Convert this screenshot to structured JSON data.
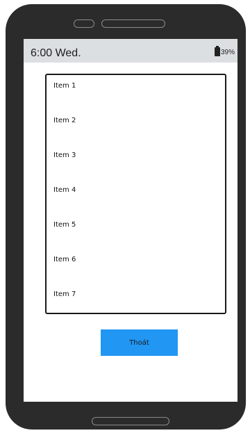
{
  "status_bar": {
    "time": "6:00 Wed.",
    "battery_percent": "39%",
    "battery_icon": "battery-icon"
  },
  "list": {
    "items": [
      {
        "label": "Item 1"
      },
      {
        "label": "Item 2"
      },
      {
        "label": "Item 3"
      },
      {
        "label": "Item 4"
      },
      {
        "label": "Item 5"
      },
      {
        "label": "Item 6"
      },
      {
        "label": "Item 7"
      }
    ]
  },
  "actions": {
    "exit_label": "Thoát"
  },
  "colors": {
    "accent": "#2196f3",
    "status_bar_bg": "#dcdfe2",
    "device_frame": "#2b2b2b"
  }
}
